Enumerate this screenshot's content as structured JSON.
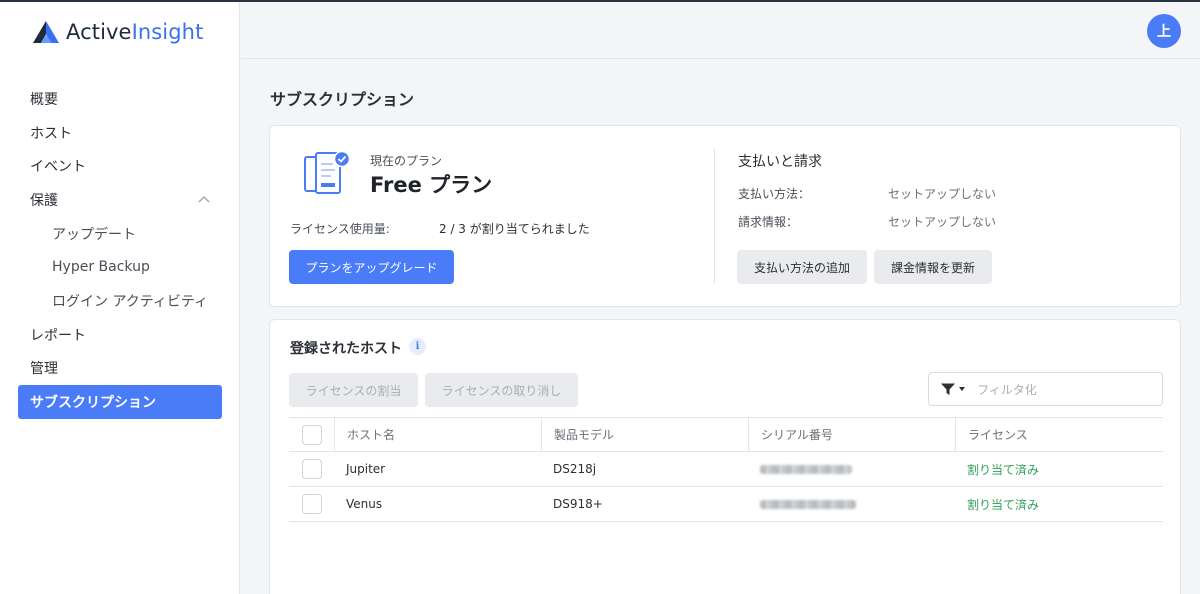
{
  "app": {
    "brand_part1": "Active",
    "brand_part2": "Insight",
    "brand_color": "#3a70f0",
    "accent_color": "#4a7cf7"
  },
  "sidebar": {
    "items": [
      {
        "label": "概要"
      },
      {
        "label": "ホスト"
      },
      {
        "label": "イベント"
      },
      {
        "label": "保護",
        "expanded": true,
        "icon": "chevron-up-icon"
      },
      {
        "label": "アップデート",
        "sub": true
      },
      {
        "label": "Hyper Backup",
        "sub": true
      },
      {
        "label": "ログイン アクティビティ",
        "sub": true
      },
      {
        "label": "レポート"
      },
      {
        "label": "管理"
      },
      {
        "label": "サブスクリプション",
        "active": true
      }
    ]
  },
  "header": {
    "avatar_initial": "上"
  },
  "page": {
    "title": "サブスクリプション"
  },
  "plan": {
    "current_plan_label": "現在のプラン",
    "plan_name": "Free プラン",
    "license_usage_label": "ライセンス使用量:",
    "license_usage_value": "2 / 3 が割り当てられました",
    "upgrade_button": "プランをアップグレード"
  },
  "billing": {
    "title": "支払いと請求",
    "payment_method_label": "支払い方法：",
    "payment_method_value": "セットアップしない",
    "billing_info_label": "請求情報：",
    "billing_info_value": "セットアップしない",
    "add_payment_button": "支払い方法の追加",
    "update_billing_button": "課金情報を更新"
  },
  "hosts": {
    "title": "登録されたホスト",
    "assign_button": "ライセンスの割当",
    "revoke_button": "ライセンスの取り消し",
    "filter_placeholder": "フィルタ化",
    "columns": [
      "ホスト名",
      "製品モデル",
      "シリアル番号",
      "ライセンス"
    ],
    "rows": [
      {
        "host": "Jupiter",
        "model": "DS218j",
        "serial": "",
        "license": "割り当て済み"
      },
      {
        "host": "Venus",
        "model": "DS918+",
        "serial": "",
        "license": "割り当て済み"
      }
    ]
  }
}
